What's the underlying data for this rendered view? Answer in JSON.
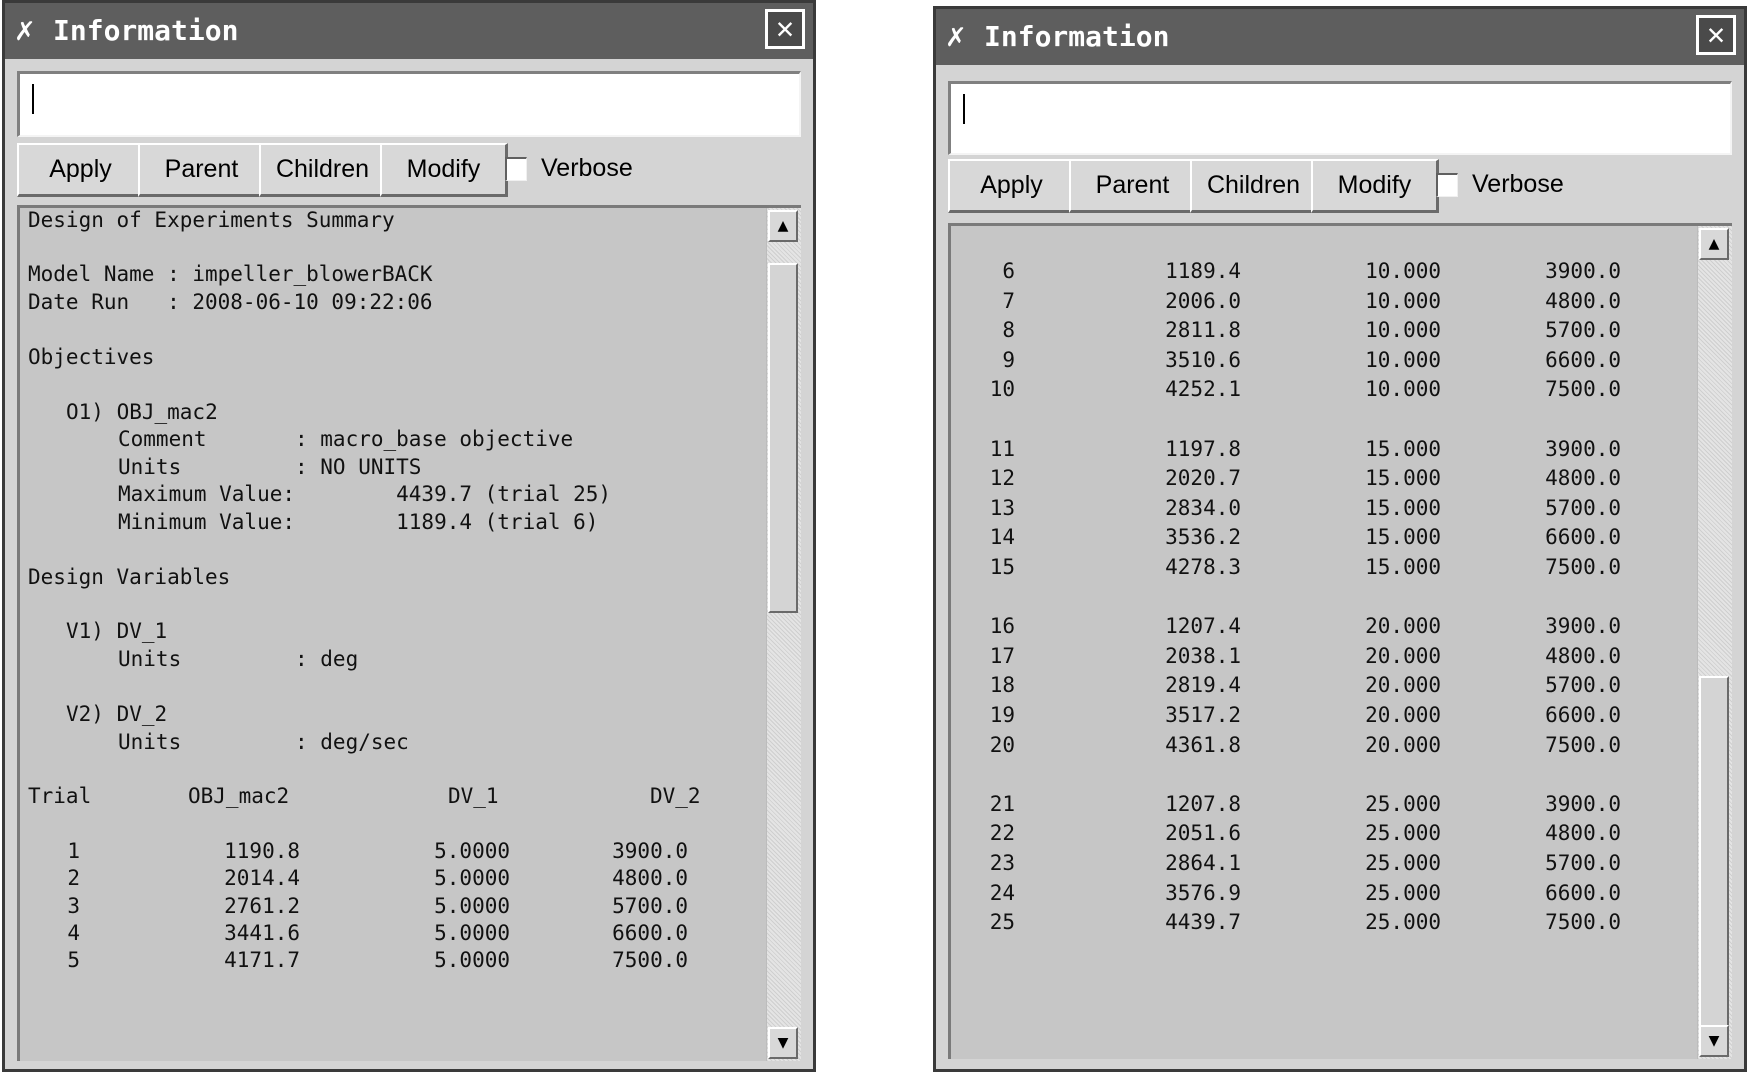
{
  "window_title": "Information",
  "buttons": {
    "apply": "Apply",
    "parent": "Parent",
    "children": "Children",
    "modify": "Modify"
  },
  "verbose_label": "Verbose",
  "summary": {
    "heading": "Design of Experiments Summary",
    "model_name_line": "Model Name : impeller_blowerBACK",
    "date_run_line": "Date Run   : 2008-06-10 09:22:06",
    "objectives_heading": "Objectives",
    "objective": {
      "id_line": "O1) OBJ_mac2",
      "comment_line": "Comment       : macro_base objective",
      "units_line": "Units         : NO UNITS",
      "max_line": "Maximum Value:        4439.7 (trial 25)",
      "min_line": "Minimum Value:        1189.4 (trial 6)"
    },
    "design_variables_heading": "Design Variables",
    "variables": [
      {
        "id_line": "V1) DV_1",
        "units_line": "Units         : deg"
      },
      {
        "id_line": "V2) DV_2",
        "units_line": "Units         : deg/sec"
      }
    ],
    "table_header": [
      "Trial",
      "OBJ_mac2",
      "DV_1",
      "DV_2"
    ]
  },
  "trials_left": [
    [
      "1",
      "1190.8",
      "5.0000",
      "3900.0"
    ],
    [
      "2",
      "2014.4",
      "5.0000",
      "4800.0"
    ],
    [
      "3",
      "2761.2",
      "5.0000",
      "5700.0"
    ],
    [
      "4",
      "3441.6",
      "5.0000",
      "6600.0"
    ],
    [
      "5",
      "4171.7",
      "5.0000",
      "7500.0"
    ]
  ],
  "trials_right": [
    [
      "6",
      "1189.4",
      "10.000",
      "3900.0"
    ],
    [
      "7",
      "2006.0",
      "10.000",
      "4800.0"
    ],
    [
      "8",
      "2811.8",
      "10.000",
      "5700.0"
    ],
    [
      "9",
      "3510.6",
      "10.000",
      "6600.0"
    ],
    [
      "10",
      "4252.1",
      "10.000",
      "7500.0"
    ],
    [
      "11",
      "1197.8",
      "15.000",
      "3900.0"
    ],
    [
      "12",
      "2020.7",
      "15.000",
      "4800.0"
    ],
    [
      "13",
      "2834.0",
      "15.000",
      "5700.0"
    ],
    [
      "14",
      "3536.2",
      "15.000",
      "6600.0"
    ],
    [
      "15",
      "4278.3",
      "15.000",
      "7500.0"
    ],
    [
      "16",
      "1207.4",
      "20.000",
      "3900.0"
    ],
    [
      "17",
      "2038.1",
      "20.000",
      "4800.0"
    ],
    [
      "18",
      "2819.4",
      "20.000",
      "5700.0"
    ],
    [
      "19",
      "3517.2",
      "20.000",
      "6600.0"
    ],
    [
      "20",
      "4361.8",
      "20.000",
      "7500.0"
    ],
    [
      "21",
      "1207.8",
      "25.000",
      "3900.0"
    ],
    [
      "22",
      "2051.6",
      "25.000",
      "4800.0"
    ],
    [
      "23",
      "2864.1",
      "25.000",
      "5700.0"
    ],
    [
      "24",
      "3576.9",
      "25.000",
      "6600.0"
    ],
    [
      "25",
      "4439.7",
      "25.000",
      "7500.0"
    ]
  ]
}
